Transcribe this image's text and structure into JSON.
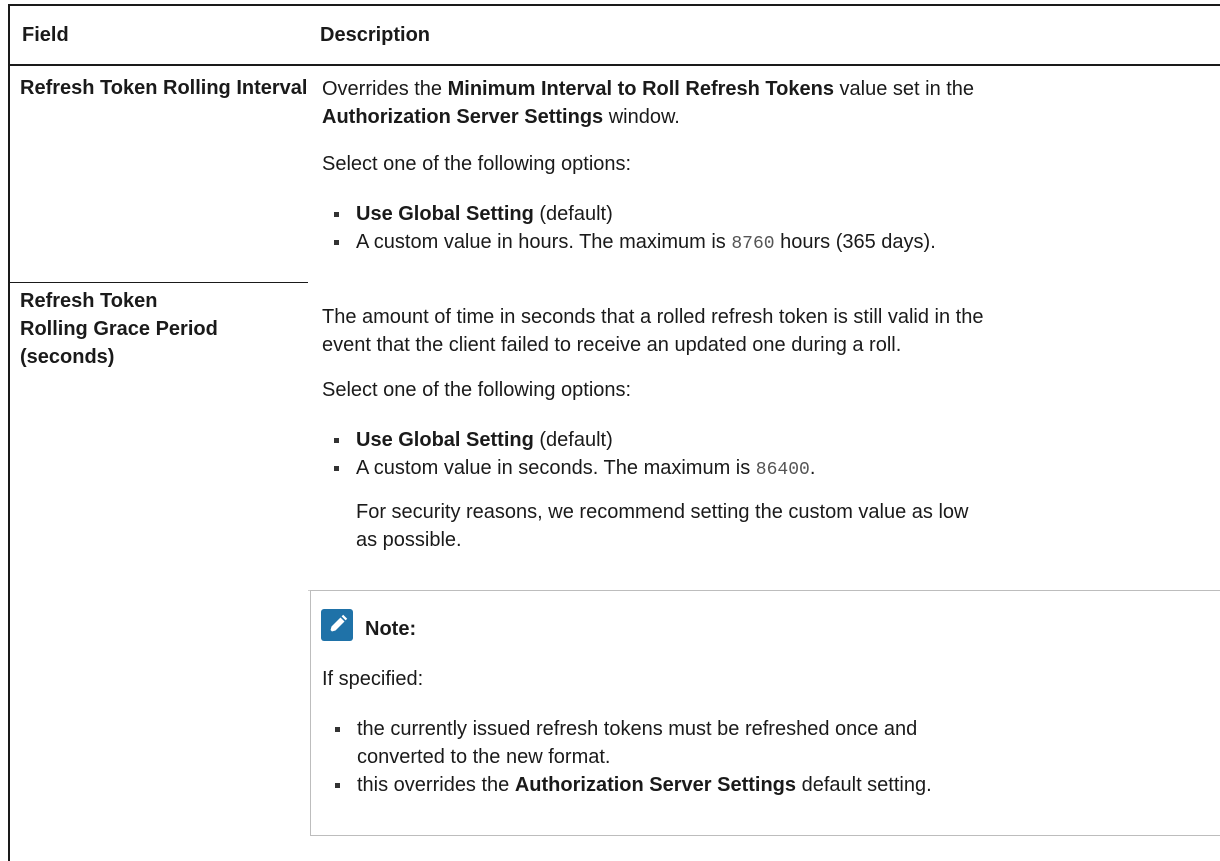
{
  "header": {
    "field": "Field",
    "description": "Description"
  },
  "row1": {
    "field": "Refresh Token Rolling Interval",
    "desc_a": "Overrides the ",
    "desc_b": "Minimum Interval to Roll Refresh Tokens",
    "desc_c": " value set in the",
    "desc_d": "Authorization Server Settings",
    "desc_e": " window.",
    "select": "Select one of the following options:",
    "opt1_bold": "Use Global Setting",
    "opt1_rest": " (default)",
    "opt2_a": "A custom value in hours. The maximum is ",
    "opt2_code": "8760",
    "opt2_b": " hours (365 days)."
  },
  "row2": {
    "field_1": "Refresh Token",
    "field_2": "Rolling Grace Period",
    "field_3": "(seconds)",
    "desc_1": "The amount of time in seconds that a rolled refresh token is still valid in the",
    "desc_2": "event that the client failed to receive an updated one during a roll.",
    "select": "Select one of the following options:",
    "opt1_bold": "Use Global Setting",
    "opt1_rest": " (default)",
    "opt2_a": "A custom value in seconds. The maximum is ",
    "opt2_code": "86400",
    "opt2_b": ".",
    "sec_1": "For security reasons, we recommend setting the custom value as low",
    "sec_2": "as possible."
  },
  "note": {
    "title": "Note:",
    "intro": "If specified:",
    "item1_1": "the currently issued refresh tokens must be refreshed once and",
    "item1_2": "converted to the new format.",
    "item2_a": "this overrides the ",
    "item2_bold": "Authorization Server Settings",
    "item2_b": " default setting."
  },
  "colors": {
    "note_icon": "#1f72a8",
    "text": "#1a1a1a",
    "code": "#555555"
  },
  "icons": {
    "note": "pencil-note-icon"
  }
}
